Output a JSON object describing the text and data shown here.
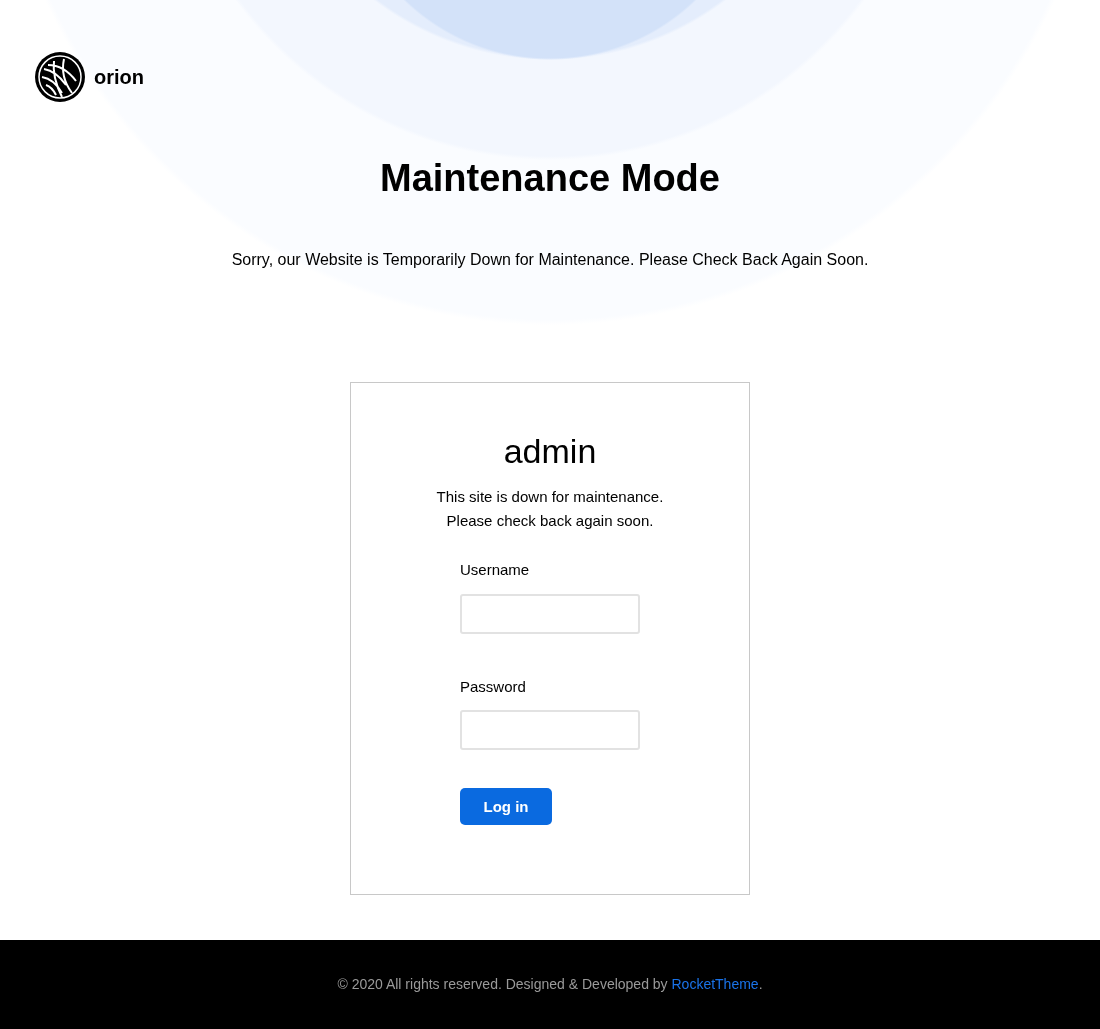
{
  "brand": {
    "name": "orion"
  },
  "hero": {
    "title": "Maintenance Mode",
    "message": "Sorry, our Website is Temporarily Down for Maintenance. Please Check Back Again Soon."
  },
  "login": {
    "title": "admin",
    "notice": [
      "This site is down for maintenance.",
      "Please check back again soon."
    ],
    "fields": [
      {
        "label": "Username"
      },
      {
        "label": "Password"
      }
    ],
    "button": "Log in"
  },
  "footer": {
    "text": "© 2020 All rights reserved. Designed & Developed by",
    "link": "RocketTheme",
    "suffix": "."
  }
}
